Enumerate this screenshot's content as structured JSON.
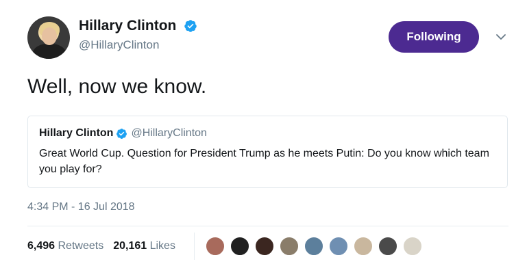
{
  "author": {
    "display_name": "Hillary Clinton",
    "handle": "@HillaryClinton",
    "verified": true
  },
  "follow_button": {
    "label": "Following",
    "color": "#4c2a91"
  },
  "tweet": {
    "text": "Well, now we know."
  },
  "quoted_tweet": {
    "display_name": "Hillary Clinton",
    "handle": "@HillaryClinton",
    "text": "Great World Cup. Question for President Trump as he meets Putin: Do you know which team you play for?"
  },
  "timestamp": "4:34 PM - 16 Jul 2018",
  "stats": {
    "retweets_count": "6,496",
    "retweets_label": "Retweets",
    "likes_count": "20,161",
    "likes_label": "Likes"
  },
  "liker_avatars": [
    {
      "name": "liker-avatar-1",
      "color": "#a86a5c"
    },
    {
      "name": "liker-avatar-2",
      "color": "#202020"
    },
    {
      "name": "liker-avatar-3",
      "color": "#3b2620"
    },
    {
      "name": "liker-avatar-4",
      "color": "#8a7d6a"
    },
    {
      "name": "liker-avatar-5",
      "color": "#5c7f9c"
    },
    {
      "name": "liker-avatar-6",
      "color": "#6f8fb2"
    },
    {
      "name": "liker-avatar-7",
      "color": "#c9b79e"
    },
    {
      "name": "liker-avatar-8",
      "color": "#4a4a4a"
    },
    {
      "name": "liker-avatar-9",
      "color": "#d9d4c8"
    }
  ],
  "colors": {
    "verified_badge": "#1da1f2",
    "secondary_text": "#657786"
  }
}
